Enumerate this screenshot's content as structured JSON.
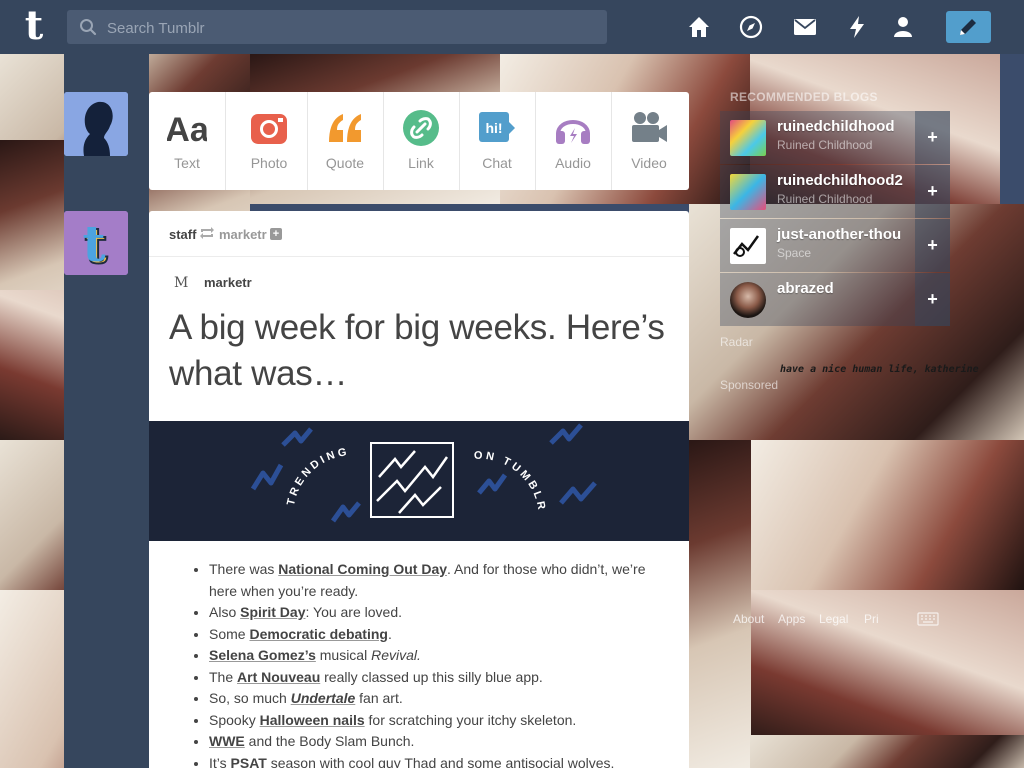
{
  "search": {
    "placeholder": "Search Tumblr"
  },
  "post_types": [
    {
      "label": "Text",
      "icon": "text-icon"
    },
    {
      "label": "Photo",
      "icon": "camera-icon"
    },
    {
      "label": "Quote",
      "icon": "quote-icon"
    },
    {
      "label": "Link",
      "icon": "link-icon"
    },
    {
      "label": "Chat",
      "icon": "chat-icon"
    },
    {
      "label": "Audio",
      "icon": "headphones-icon"
    },
    {
      "label": "Video",
      "icon": "video-camera-icon"
    }
  ],
  "post": {
    "reblogger": "staff",
    "source": "marketr",
    "source_icon": "M",
    "title": "A big week for big weeks. Here’s what was…",
    "banner": {
      "left": "TRENDING",
      "right": "ON TUMBLR"
    },
    "items": [
      {
        "pre": "There was ",
        "link": "National Coming Out Day",
        "post": ". And for those who didn’t, we’re here when you’re ready."
      },
      {
        "pre": "Also ",
        "link": "Spirit Day",
        "post": ": You are loved."
      },
      {
        "pre": "Some ",
        "link": "Democratic debating",
        "post": "."
      },
      {
        "pre": "",
        "link": "Selena Gomez’s",
        "post": " musical ",
        "em": "Revival."
      },
      {
        "pre": "The ",
        "link": "Art Nouveau",
        "post": " really classed up this silly blue app."
      },
      {
        "pre": "So, so much ",
        "link": "Undertale",
        "post": " fan art."
      },
      {
        "pre": "Spooky ",
        "link": "Halloween nails",
        "post": " for scratching your itchy skeleton."
      },
      {
        "pre": "",
        "link": "WWE",
        "post": " and the Body Slam Bunch."
      },
      {
        "pre": "It’s ",
        "link": "PSAT",
        "post": " season with cool guy Thad and some antisocial wolves."
      }
    ]
  },
  "recommended": {
    "title": "RECOMMENDED BLOGS",
    "blogs": [
      {
        "name": "ruinedchildhood",
        "sub": "Ruined Childhood"
      },
      {
        "name": "ruinedchildhood2",
        "sub": "Ruined Childhood"
      },
      {
        "name": "just-another-thou",
        "sub": "Space"
      },
      {
        "name": "abrazed",
        "sub": ""
      }
    ],
    "links": [
      "Radar",
      "Sponsored"
    ],
    "caption": "have a nice human life, katherine"
  },
  "footer": {
    "links": [
      "About",
      "Apps",
      "Legal",
      "Pri"
    ]
  },
  "colors": {
    "topbar": "#36465d",
    "accent": "#529ecc",
    "photo": "#e8604c",
    "quote": "#f2992e",
    "link": "#56bc8a",
    "chat": "#529ecc",
    "audio": "#a77dc2",
    "video": "#748089"
  }
}
